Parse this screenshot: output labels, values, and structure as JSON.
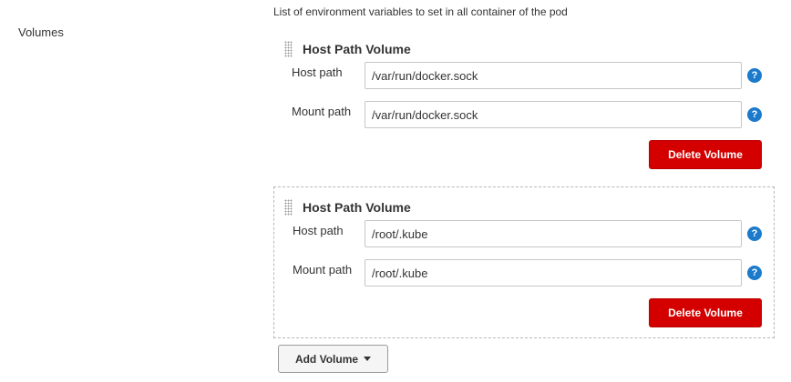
{
  "description": "List of environment variables to set in all container of the pod",
  "section_label": "Volumes",
  "volumes": [
    {
      "title": "Host Path Volume",
      "host_path_label": "Host path",
      "host_path_value": "/var/run/docker.sock",
      "mount_path_label": "Mount path",
      "mount_path_value": "/var/run/docker.sock",
      "help_glyph": "?",
      "delete_label": "Delete Volume"
    },
    {
      "title": "Host Path Volume",
      "host_path_label": "Host path",
      "host_path_value": "/root/.kube",
      "mount_path_label": "Mount path",
      "mount_path_value": "/root/.kube",
      "help_glyph": "?",
      "delete_label": "Delete Volume"
    }
  ],
  "add_volume_label": "Add Volume",
  "icons": {
    "drag_handle": "drag-handle-icon",
    "help": "help-icon",
    "dropdown": "caret-down-icon"
  },
  "colors": {
    "delete_button": "#d40000",
    "help_icon": "#1b7acb"
  }
}
